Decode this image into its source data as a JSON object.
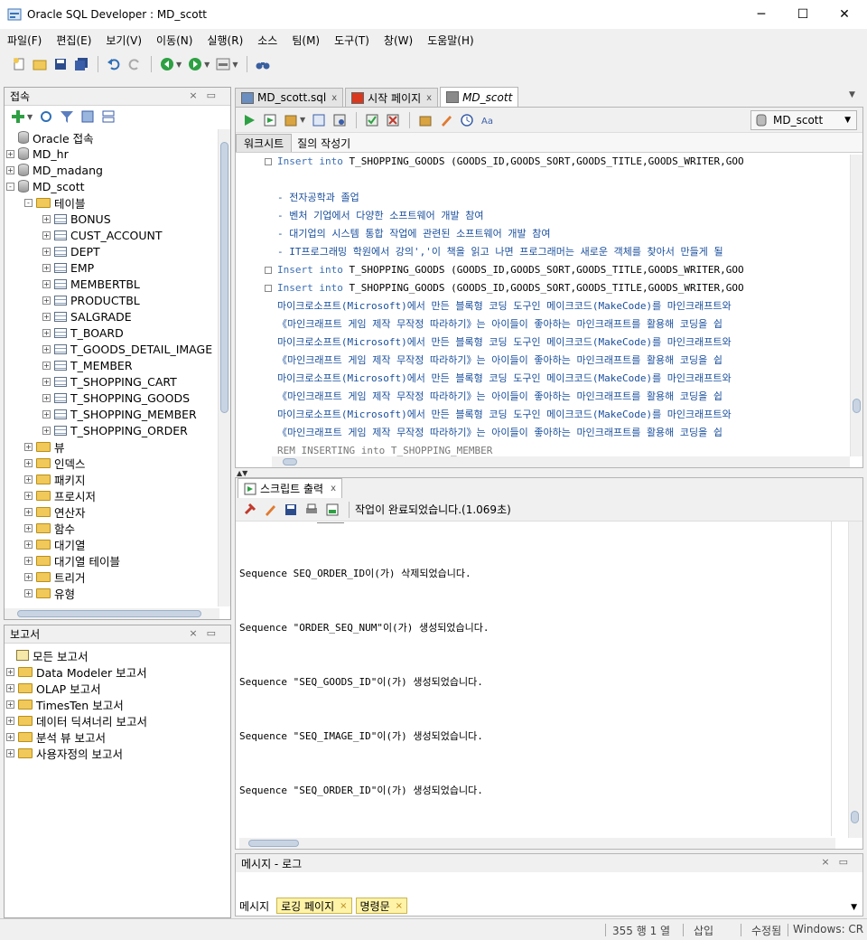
{
  "window": {
    "title": "Oracle SQL Developer : MD_scott",
    "minimize": "─",
    "maximize": "☐",
    "close": "✕"
  },
  "menu": [
    "파일(F)",
    "편집(E)",
    "보기(V)",
    "이동(N)",
    "실행(R)",
    "소스",
    "팀(M)",
    "도구(T)",
    "창(W)",
    "도움말(H)"
  ],
  "connections": {
    "title": "접속",
    "root": "Oracle 접속",
    "items": [
      "MD_hr",
      "MD_madang",
      "MD_scott"
    ],
    "tables_label": "테이블",
    "tables": [
      "BONUS",
      "CUST_ACCOUNT",
      "DEPT",
      "EMP",
      "MEMBERTBL",
      "PRODUCTBL",
      "SALGRADE",
      "T_BOARD",
      "T_GOODS_DETAIL_IMAGE",
      "T_MEMBER",
      "T_SHOPPING_CART",
      "T_SHOPPING_GOODS",
      "T_SHOPPING_MEMBER",
      "T_SHOPPING_ORDER"
    ],
    "other_nodes": [
      "뷰",
      "인덱스",
      "패키지",
      "프로시저",
      "연산자",
      "함수",
      "대기열",
      "대기열 테이블",
      "트리거",
      "유형"
    ]
  },
  "reports": {
    "title": "보고서",
    "root": "모든 보고서",
    "items": [
      "Data Modeler 보고서",
      "OLAP 보고서",
      "TimesTen 보고서",
      "데이터 딕셔너리 보고서",
      "분석 뷰 보고서",
      "사용자정의 보고서"
    ]
  },
  "tabs": [
    {
      "label": "MD_scott.sql",
      "close": "x"
    },
    {
      "label": "시작 페이지",
      "close": "x"
    },
    {
      "label": "MD_scott",
      "close": ""
    }
  ],
  "editor": {
    "connection": "MD_scott",
    "subtabs": [
      "워크시트",
      "질의 작성기"
    ],
    "lines": [
      {
        "type": "ins",
        "kw1": "Insert",
        "kw2": "into",
        "rest": " T_SHOPPING_GOODS (GOODS_ID,GOODS_SORT,GOODS_TITLE,GOODS_WRITER,GOO"
      },
      {
        "type": "text",
        "text": ""
      },
      {
        "type": "text",
        "text": "- 전자공학과 졸업"
      },
      {
        "type": "text",
        "text": "- 벤처 기업에서 다양한 소프트웨어 개발 참여"
      },
      {
        "type": "text",
        "text": "- 대기업의 시스템 통합 작업에 관련된 소프트웨어 개발 참여"
      },
      {
        "type": "text",
        "text": "- IT프로그래밍 학원에서 강의','이 책을 읽고 나면 프로그래머는 새로운 객체를 찾아서 만들게 될"
      },
      {
        "type": "ins",
        "kw1": "Insert",
        "kw2": "into",
        "rest": " T_SHOPPING_GOODS (GOODS_ID,GOODS_SORT,GOODS_TITLE,GOODS_WRITER,GOO"
      },
      {
        "type": "ins",
        "kw1": "Insert",
        "kw2": "into",
        "rest": " T_SHOPPING_GOODS (GOODS_ID,GOODS_SORT,GOODS_TITLE,GOODS_WRITER,GOO"
      },
      {
        "type": "text",
        "text": "마이크로소프트(Microsoft)에서 만든 블록형 코딩 도구인 메이크코드(MakeCode)를 마인크래프트와"
      },
      {
        "type": "text",
        "text": "《마인크래프트 게임 제작 무작정 따라하기》는 아이들이 좋아하는 마인크래프트를 활용해 코딩을 쉽"
      },
      {
        "type": "text",
        "text": "마이크로소프트(Microsoft)에서 만든 블록형 코딩 도구인 메이크코드(MakeCode)를 마인크래프트와"
      },
      {
        "type": "text",
        "text": "《마인크래프트 게임 제작 무작정 따라하기》는 아이들이 좋아하는 마인크래프트를 활용해 코딩을 쉽"
      },
      {
        "type": "text",
        "text": "마이크로소프트(Microsoft)에서 만든 블록형 코딩 도구인 메이크코드(MakeCode)를 마인크래프트와"
      },
      {
        "type": "text",
        "text": "《마인크래프트 게임 제작 무작정 따라하기》는 아이들이 좋아하는 마인크래프트를 활용해 코딩을 쉽"
      },
      {
        "type": "text",
        "text": "마이크로소프트(Microsoft)에서 만든 블록형 코딩 도구인 메이크코드(MakeCode)를 마인크래프트와"
      },
      {
        "type": "text",
        "text": "《마인크래프트 게임 제작 무작정 따라하기》는 아이들이 좋아하는 마인크래프트를 활용해 코딩을 쉽"
      },
      {
        "type": "rem",
        "text": "REM INSERTING into T_SHOPPING_MEMBER"
      }
    ]
  },
  "script_output": {
    "title": "스크립트 출력",
    "close": "x",
    "status": "작업이 완료되었습니다.(1.069초)",
    "lines": [
      "Sequence SEQ_ORDER_ID이(가) 삭제되었습니다.",
      "Sequence \"ORDER_SEQ_NUM\"이(가) 생성되었습니다.",
      "Sequence \"SEQ_GOODS_ID\"이(가) 생성되었습니다.",
      "Sequence \"SEQ_IMAGE_ID\"이(가) 생성되었습니다.",
      "Sequence \"SEQ_ORDER_ID\"이(가) 생성되었습니다."
    ]
  },
  "messages": {
    "title": "메시지 - 로그",
    "tabs": [
      "메시지",
      "로깅 페이지",
      "명령문"
    ],
    "close": "×"
  },
  "status": {
    "position": "355 행 1 열",
    "mode": "삽입",
    "modified": "수정됨",
    "eol": "Windows: CR"
  }
}
